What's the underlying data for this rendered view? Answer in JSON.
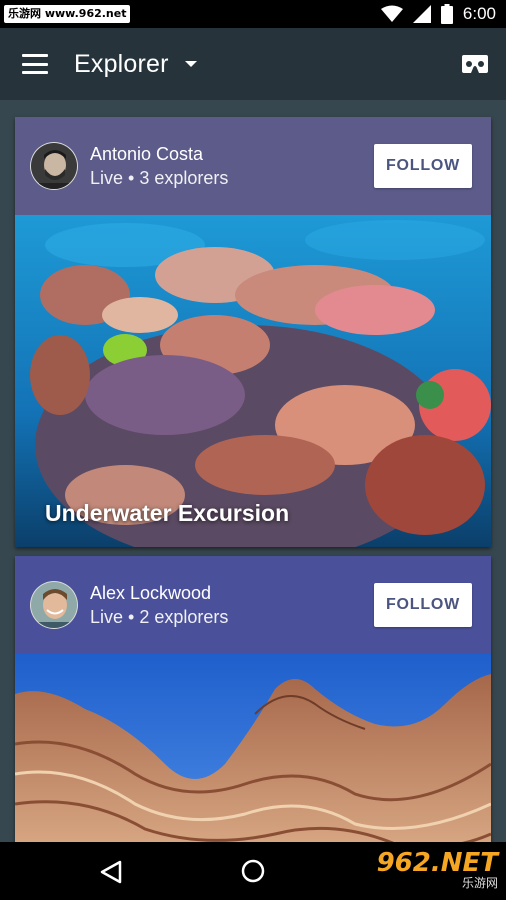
{
  "status_bar": {
    "watermark": "乐游网 www.962.net",
    "time": "6:00"
  },
  "app_bar": {
    "title": "Explorer"
  },
  "cards": [
    {
      "user_name": "Antonio Costa",
      "subtitle": "Live • 3 explorers",
      "follow_label": "FOLLOW",
      "caption": "Underwater Excursion",
      "header_color": "#5c5b8a"
    },
    {
      "user_name": "Alex Lockwood",
      "subtitle": "Live • 2 explorers",
      "follow_label": "FOLLOW",
      "caption": "",
      "header_color": "#4a519a"
    }
  ],
  "nav_watermark": {
    "main": "962.NET",
    "sub": "乐游网"
  },
  "colors": {
    "app_bar": "#26333b",
    "background": "#37474f"
  }
}
